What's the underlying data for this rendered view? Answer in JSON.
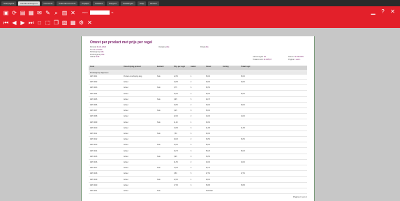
{
  "tabs": [
    "Startpagina",
    "Dashboardrapport",
    "Overzicht",
    "Kalenderoverzicht",
    "Prijslijst",
    "Relaties",
    "Rapport",
    "Instellingen",
    "Help",
    "Beheer"
  ],
  "toolbar": {
    "row1_icons": [
      "save-icon",
      "refresh-icon",
      "print-icon",
      "export-icon",
      "email-icon",
      "edit-icon",
      "search-icon",
      "delete-icon",
      "close-icon"
    ],
    "zoom_label": "Zoom",
    "zoom_value": "",
    "zoom_suffix": "%",
    "row2_icons": [
      "first-page-icon",
      "previous-page-icon",
      "next-page-icon",
      "last-page-icon",
      "fit-page-icon",
      "fit-width-icon",
      "copy-icon",
      "layout-icon",
      "grid-icon",
      "settings-icon",
      "close-icon"
    ],
    "right_icons": [
      "minimize-icon",
      "help-icon",
      "close-icon"
    ]
  },
  "report": {
    "title": "Omzet per product met prijs per regel",
    "meta_left": [
      {
        "k": "Periode",
        "v": "01-01-2024"
      },
      {
        "k": "Tot",
        "v": "31-12-2024"
      },
      {
        "k": "Relatiegroep",
        "v": "Alle"
      },
      {
        "k": "Productgroep",
        "v": "Alle"
      },
      {
        "k": "Valuta",
        "v": "EUR"
      }
    ],
    "meta_mid": [
      {
        "k": "Vestiging",
        "v": "Alle"
      }
    ],
    "meta_right": [
      {
        "k": "Filiaal",
        "v": "Alle"
      }
    ],
    "meta_far_left": [
      {
        "k": "Aantal regels",
        "v": "23"
      },
      {
        "k": "Totaal omzet",
        "v": "12.345,67"
      }
    ],
    "meta_far_right": [
      {
        "k": "Datum",
        "v": "12-03-2025"
      },
      {
        "k": "Pagina",
        "v": "1 van 1"
      }
    ],
    "headers": [
      "Code",
      "Omschrijving product",
      "Eenheid",
      "Prijs per regel",
      "Aantal",
      "Omzet",
      "Korting",
      "Totaal regel"
    ],
    "group_label": "Productgroep: Algemeen",
    "rows": [
      [
        "ART-0001",
        "Product omschrijving lang",
        "Stuk",
        "12,50",
        "4",
        "50,00",
        "",
        "50,00"
      ],
      [
        "ART-0002",
        "Artikel",
        "",
        "24,95",
        "2",
        "49,90",
        "",
        "49,90"
      ],
      [
        "ART-0003",
        "Artikel",
        "Stuk",
        "8,75",
        "6",
        "52,50",
        "",
        ""
      ],
      [
        "ART-0004",
        "Artikel",
        "",
        "15,00",
        "3",
        "45,00",
        "",
        "45,00"
      ],
      [
        "ART-0005",
        "Artikel",
        "Stuk",
        "9,95",
        "5",
        "49,75",
        "",
        ""
      ],
      [
        "ART-0006",
        "Artikel",
        "",
        "19,50",
        "2",
        "39,00",
        "",
        "39,00"
      ],
      [
        "ART-0007",
        "Artikel",
        "Stuk",
        "6,25",
        "8",
        "50,00",
        "",
        ""
      ],
      [
        "ART-0008",
        "Artikel",
        "",
        "22,00",
        "2",
        "44,00",
        "",
        "44,00"
      ],
      [
        "ART-0009",
        "Artikel",
        "Stuk",
        "11,40",
        "4",
        "45,60",
        "",
        ""
      ],
      [
        "ART-0010",
        "Artikel",
        "",
        "13,95",
        "3",
        "41,85",
        "",
        "41,85"
      ],
      [
        "ART-0011",
        "Artikel",
        "Stuk",
        "7,50",
        "6",
        "45,00",
        "",
        ""
      ],
      [
        "ART-0012",
        "Artikel",
        "",
        "18,25",
        "2",
        "36,50",
        "",
        "36,50"
      ],
      [
        "ART-0013",
        "Artikel",
        "Stuk",
        "10,00",
        "5",
        "50,00",
        "",
        ""
      ],
      [
        "ART-0014",
        "Artikel",
        "",
        "16,75",
        "3",
        "50,25",
        "",
        "50,25"
      ],
      [
        "ART-0015",
        "Artikel",
        "Stuk",
        "5,95",
        "9",
        "53,55",
        "",
        ""
      ],
      [
        "ART-0016",
        "Artikel",
        "",
        "21,50",
        "2",
        "43,00",
        "",
        "43,00"
      ],
      [
        "ART-0017",
        "Artikel",
        "Stuk",
        "14,25",
        "3",
        "42,75",
        "",
        ""
      ],
      [
        "ART-0018",
        "Artikel",
        "",
        "9,50",
        "5",
        "47,50",
        "",
        "47,50"
      ],
      [
        "ART-0019",
        "Artikel",
        "Stuk",
        "12,00",
        "4",
        "48,00",
        "",
        ""
      ],
      [
        "ART-0020",
        "Artikel",
        "",
        "17,95",
        "3",
        "53,85",
        "",
        "53,85"
      ],
      [
        "ART-0021",
        "Artikel",
        "Stuk",
        "",
        "",
        "Subtotaal",
        "",
        ""
      ]
    ],
    "footer": "Pagina 1 van 1"
  },
  "colors": {
    "toolbar": "#e3202a",
    "title": "#7a1f6a"
  }
}
